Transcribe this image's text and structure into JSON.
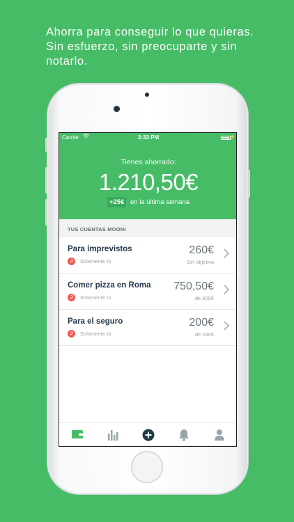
{
  "promo": {
    "text": "Ahorra para conseguir lo que quieras.\nSin esfuerzo, sin preocuparte y sin notarlo."
  },
  "status_bar": {
    "carrier": "Carrier",
    "time": "3:33 PM"
  },
  "header": {
    "saved_label": "Tienes ahorrado:",
    "saved_amount": "1.210,50€",
    "weekly_change": "+25€",
    "weekly_label": "en la última semana"
  },
  "accounts_section_title": "TUS CUENTAS MOONI",
  "accounts": [
    {
      "name": "Para imprevistos",
      "owner_initial": "J",
      "owner": "Solamente tú",
      "amount": "260€",
      "goal": "Sin objetivo"
    },
    {
      "name": "Comer pizza en Roma",
      "owner_initial": "J",
      "owner": "Solamente tú",
      "amount": "750,50€",
      "goal": "de 900€"
    },
    {
      "name": "Para el seguro",
      "owner_initial": "J",
      "owner": "Solamente tú",
      "amount": "200€",
      "goal": "de 290€"
    }
  ],
  "tabbar": {
    "items": [
      {
        "icon": "wallet-icon",
        "active": true
      },
      {
        "icon": "stats-icon",
        "active": false
      },
      {
        "icon": "add-icon",
        "active": false
      },
      {
        "icon": "bell-icon",
        "active": false
      },
      {
        "icon": "profile-icon",
        "active": false
      }
    ]
  },
  "colors": {
    "brand_green": "#46bc67",
    "title_text": "#23384a",
    "avatar_red": "#ee5a52"
  }
}
